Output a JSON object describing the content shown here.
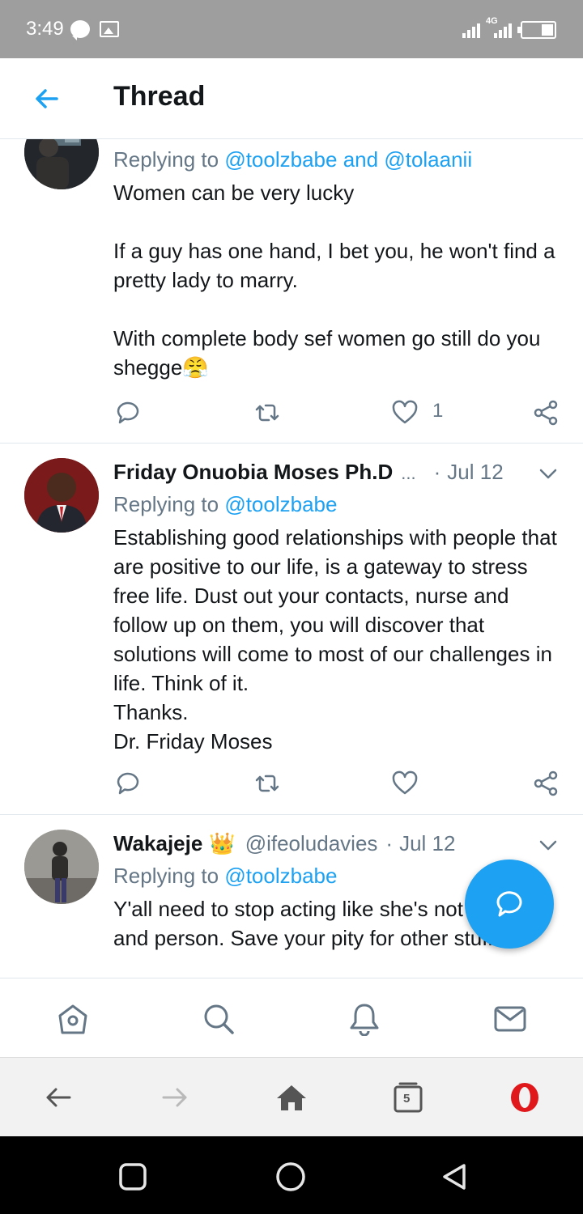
{
  "status_bar": {
    "time": "3:49",
    "network_label": "4G",
    "icons": [
      "chat-bubble-icon",
      "image-icon",
      "signal-icon",
      "battery-icon"
    ]
  },
  "header": {
    "title": "Thread",
    "back_icon": "back-arrow-icon"
  },
  "tweets": [
    {
      "replying_prefix": "Replying to",
      "replying_to_1": "@toolzbabe",
      "replying_and": "and",
      "replying_to_2": "@tolaanii",
      "lines": [
        "Women can be very lucky",
        "If a guy has one hand, I bet you, he won't find a pretty lady to marry.",
        "With complete body sef women go still do you shegge😤"
      ],
      "like_count": "1"
    },
    {
      "name": "Friday Onuobia Moses Ph.D",
      "ellipsis": "...",
      "dot": "·",
      "date": "Jul 12",
      "replying_prefix": "Replying to",
      "replying_to_1": "@toolzbabe",
      "lines": [
        "Establishing good relationships with people that are positive to our life, is a gateway to stress free life. Dust out your contacts, nurse and follow up on them, you will discover that solutions will come to most of our challenges in life. Think of it.",
        "Thanks.",
        "Dr. Friday Moses"
      ]
    },
    {
      "name": "Wakajeje",
      "badge": "👑",
      "handle": "@ifeoludavies",
      "dot": "·",
      "date": "Jul 12",
      "replying_prefix": "Replying to",
      "replying_to_1": "@toolzbabe",
      "lines": [
        "Y'all need to stop acting like she's not normal and  person. Save your pity for other stuffs"
      ]
    }
  ],
  "fab": {
    "icon": "compose-reply-icon"
  },
  "tab_bar": [
    "home-icon",
    "search-icon",
    "notifications-icon",
    "messages-icon"
  ],
  "browser_bar": {
    "tab_count": "5",
    "icons": [
      "browser-back-icon",
      "browser-forward-icon",
      "browser-home-icon",
      "tabs-icon",
      "opera-icon"
    ]
  },
  "colors": {
    "accent": "#1da1f2",
    "muted": "#657786",
    "text": "#14171a",
    "status_bar": "#9e9e9e",
    "opera_red": "#e0181b"
  }
}
